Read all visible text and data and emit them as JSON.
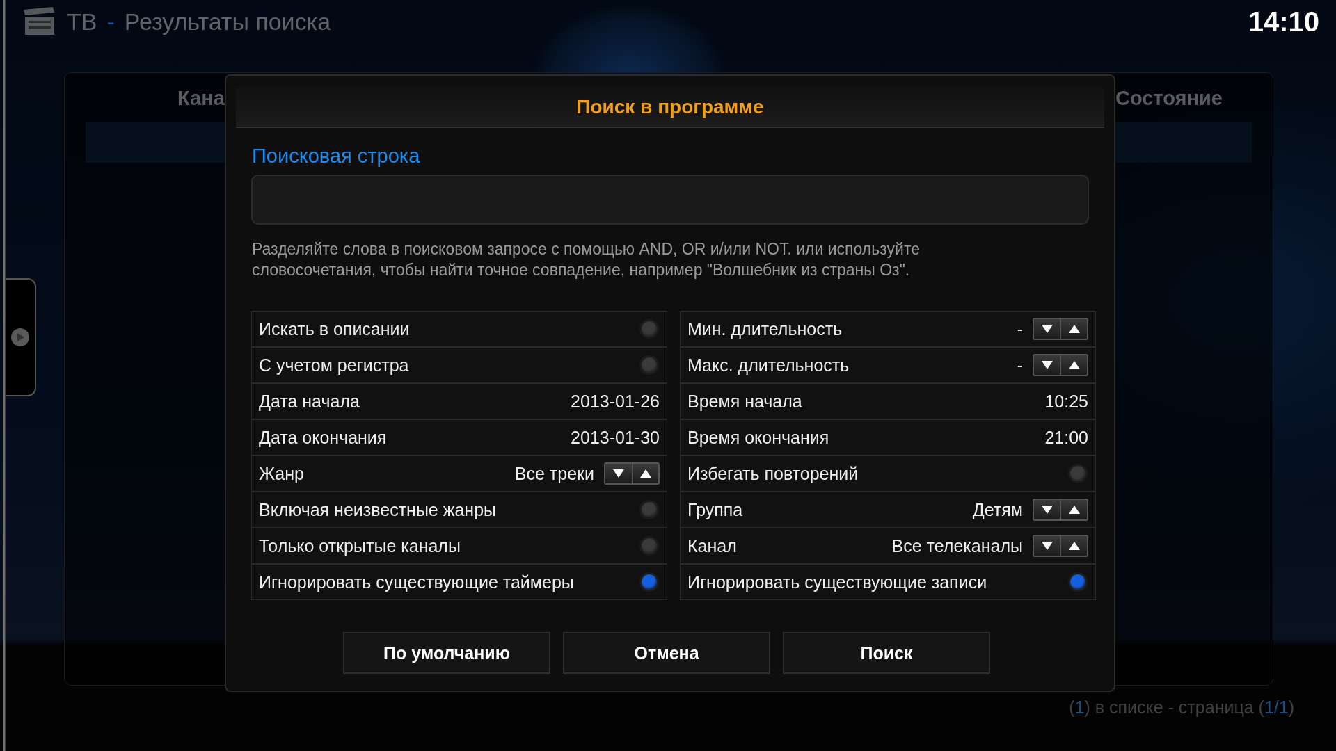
{
  "header": {
    "section": "ТВ",
    "separator": "-",
    "title": "Результаты поиска",
    "clock": "14:10"
  },
  "background_list": {
    "columns": [
      "Кана",
      "Состояние"
    ]
  },
  "dialog": {
    "title": "Поиск в программе",
    "search_label": "Поисковая строка",
    "help": "Разделяйте слова в поисковом запросе с помощью AND, OR и/или NOT. или используйте словосочетания, чтобы найти точное совпадение, например \"Волшебник из страны Оз\".",
    "options_left": [
      {
        "kind": "toggle",
        "label": "Искать в описании",
        "on": false
      },
      {
        "kind": "toggle",
        "label": "С учетом регистра",
        "on": false
      },
      {
        "kind": "value",
        "label": "Дата начала",
        "value": "2013-01-26"
      },
      {
        "kind": "value",
        "label": "Дата окончания",
        "value": "2013-01-30"
      },
      {
        "kind": "spinner",
        "label": "Жанр",
        "value": "Все треки"
      },
      {
        "kind": "toggle",
        "label": "Включая неизвестные жанры",
        "on": false
      },
      {
        "kind": "toggle",
        "label": "Только открытые каналы",
        "on": false
      },
      {
        "kind": "toggle",
        "label": "Игнорировать существующие таймеры",
        "on": true
      }
    ],
    "options_right": [
      {
        "kind": "spinner",
        "label": "Мин. длительность",
        "value": "-"
      },
      {
        "kind": "spinner",
        "label": "Макс. длительность",
        "value": "-"
      },
      {
        "kind": "value",
        "label": "Время начала",
        "value": "10:25"
      },
      {
        "kind": "value",
        "label": "Время окончания",
        "value": "21:00"
      },
      {
        "kind": "toggle",
        "label": "Избегать повторений",
        "on": false
      },
      {
        "kind": "spinner",
        "label": "Группа",
        "value": "Детям"
      },
      {
        "kind": "spinner",
        "label": "Канал",
        "value": "Все телеканалы"
      },
      {
        "kind": "toggle",
        "label": "Игнорировать существующие записи",
        "on": true
      }
    ],
    "buttons": [
      "По умолчанию",
      "Отмена",
      "Поиск"
    ]
  },
  "footer": [
    {
      "text": "(",
      "accent": false
    },
    {
      "text": "1",
      "accent": true
    },
    {
      "text": ") в списке - страница (",
      "accent": false
    },
    {
      "text": "1/1",
      "accent": true
    },
    {
      "text": ")",
      "accent": false
    }
  ]
}
